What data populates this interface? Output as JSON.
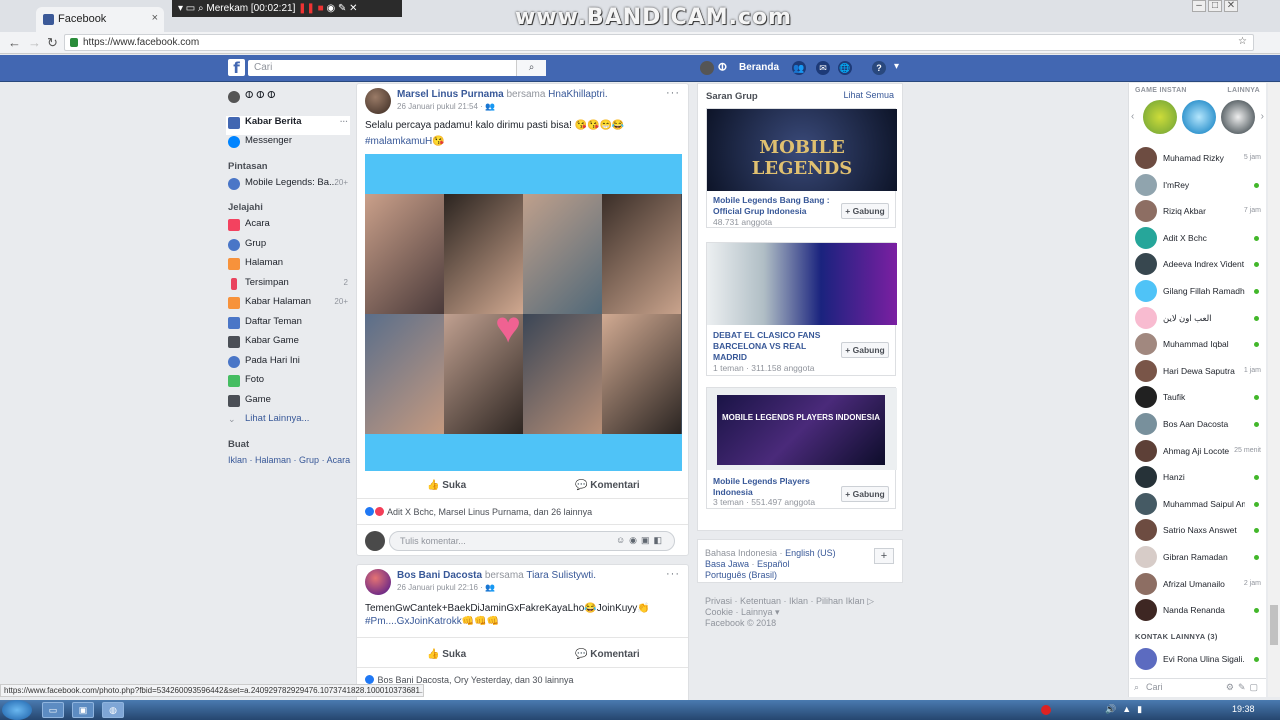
{
  "browser": {
    "tab_title": "Facebook",
    "tab_close": "×",
    "url": "https://www.facebook.com",
    "back": "←",
    "forward": "→",
    "reload": "C"
  },
  "recorder": {
    "status": "Merekam [00:02:21]",
    "watermark": "www.BANDICAM.com"
  },
  "fb_header": {
    "search_placeholder": "Cari",
    "search_icon": "⌕",
    "user_name": "ⵀ",
    "home_label": "Beranda",
    "help": "?",
    "menu": "▾"
  },
  "left_nav": {
    "profile_name": "ⵀ ⵀ ⵀ",
    "main_items": [
      {
        "label": "Kabar Berita",
        "extra": "···"
      },
      {
        "label": "Messenger",
        "extra": ""
      }
    ],
    "shortcuts_heading": "Pintasan",
    "shortcuts": [
      {
        "label": "Mobile Legends: Ba...",
        "count": "20+"
      }
    ],
    "explore_heading": "Jelajahi",
    "explore": [
      {
        "label": "Acara",
        "count": ""
      },
      {
        "label": "Grup",
        "count": ""
      },
      {
        "label": "Halaman",
        "count": ""
      },
      {
        "label": "Tersimpan",
        "count": "2"
      },
      {
        "label": "Kabar Halaman",
        "count": "20+"
      },
      {
        "label": "Daftar Teman",
        "count": ""
      },
      {
        "label": "Kabar Game",
        "count": ""
      },
      {
        "label": "Pada Hari Ini",
        "count": ""
      },
      {
        "label": "Foto",
        "count": ""
      },
      {
        "label": "Game",
        "count": ""
      },
      {
        "label": "Lihat Lainnya...",
        "count": ""
      }
    ],
    "create_heading": "Buat",
    "create_links": [
      "Iklan",
      "Halaman",
      "Grup",
      "Acara"
    ]
  },
  "posts": [
    {
      "author": "Marsel Linus Purnama",
      "with_text": "bersama",
      "tagged": "HnaKhillaptri.",
      "time": "26 Januari pukul 21:54 · ",
      "text": "Selalu percaya padamu! kalo dirimu pasti bisa! 😘😘😁😂",
      "hashtag": "#malamkamuH😘",
      "like_label": "Suka",
      "comment_label": "Komentari",
      "reactions": "Adit X Bchc, Marsel Linus Purnama, dan 26 lainnya",
      "comment_placeholder": "Tulis komentar..."
    },
    {
      "author": "Bos Bani Dacosta",
      "with_text": "bersama",
      "tagged": "Tiara Sulistywti.",
      "time": "26 Januari pukul 22:16 · ",
      "text": "TemenGwCantek+BaekDiJaminGxFakreKayaLho😂JoinKuyy👏",
      "hashtag": "#Pm....GxJoinKatrokk👊👊👊",
      "like_label": "Suka",
      "comment_label": "Komentari",
      "reactions": "Bos Bani Dacosta, Ory Yesterday, dan 30 lainnya"
    }
  ],
  "suggested_groups": {
    "heading": "Saran Grup",
    "see_all": "Lihat Semua",
    "join_label": "+ Gabung",
    "groups": [
      {
        "name": "Mobile Legends Bang Bang : Official Grup Indonesia",
        "members": "48.731 anggota",
        "image_text": "MOBILE LEGENDS"
      },
      {
        "name": "DEBAT EL CLASICO FANS BARCELONA VS REAL MADRID",
        "members": "1 teman · 311.158 anggota",
        "image_text": ""
      },
      {
        "name": "Mobile Legends Players Indonesia",
        "members": "3 teman · 551.497 anggota",
        "image_text": "MOBILE LEGENDS PLAYERS INDONESIA"
      }
    ]
  },
  "footer": {
    "languages_line1": "Bahasa Indonesia · ",
    "lang_en": "English (US)",
    "lang_jv": "Basa Jawa",
    "lang_es": "Español",
    "lang_pt": "Português (Brasil)",
    "add": "+",
    "links_line1": "Privasi · Ketentuan · Iklan · Pilihan Iklan ▷",
    "links_line2": "Cookie · Lainnya ▾",
    "copyright": "Facebook © 2018"
  },
  "chat": {
    "games_heading": "GAME INSTAN",
    "games_more": "LAINNYA",
    "contacts": [
      {
        "name": "Muhamad Rizky",
        "status": "5 jam",
        "online": false,
        "color": "#6d4c41"
      },
      {
        "name": "I'mRey",
        "status": "",
        "online": true,
        "color": "#90a4ae"
      },
      {
        "name": "Riziq Akbar",
        "status": "7 jam",
        "online": false,
        "color": "#8d6e63"
      },
      {
        "name": "Adit X Bchc",
        "status": "",
        "online": true,
        "color": "#26a69a"
      },
      {
        "name": "Adeeva Indrex Vident X",
        "status": "",
        "online": true,
        "color": "#37474f"
      },
      {
        "name": "Gilang Fillah Ramadh...",
        "status": "",
        "online": true,
        "color": "#4fc3f7"
      },
      {
        "name": "العب اون لاين",
        "status": "",
        "online": true,
        "color": "#f8bbd0"
      },
      {
        "name": "Muhammad Iqbal",
        "status": "",
        "online": true,
        "color": "#a1887f"
      },
      {
        "name": "Hari Dewa Saputra",
        "status": "1 jam",
        "online": false,
        "color": "#795548"
      },
      {
        "name": "Taufik",
        "status": "",
        "online": true,
        "color": "#212121"
      },
      {
        "name": "Bos Aan Dacosta",
        "status": "",
        "online": true,
        "color": "#78909c"
      },
      {
        "name": "Ahmag Aji Locote",
        "status": "25 menit",
        "online": false,
        "color": "#5d4037"
      },
      {
        "name": "Hanzi",
        "status": "",
        "online": true,
        "color": "#263238"
      },
      {
        "name": "Muhammad Saipul Anwar",
        "status": "",
        "online": true,
        "color": "#455a64"
      },
      {
        "name": "Satrio Naxs Answet",
        "status": "",
        "online": true,
        "color": "#6d4c41"
      },
      {
        "name": "Gibran Ramadan",
        "status": "",
        "online": true,
        "color": "#d7ccc8"
      },
      {
        "name": "Afrizal Umanailo",
        "status": "2 jam",
        "online": false,
        "color": "#8d6e63"
      },
      {
        "name": "Nanda Renanda",
        "status": "",
        "online": true,
        "color": "#3e2723"
      }
    ],
    "more_contacts_heading": "KONTAK LAINNYA (3)",
    "more_contacts": [
      {
        "name": "Evi Rona Ulina Sigali...",
        "status": "",
        "online": true,
        "color": "#5c6bc0"
      }
    ],
    "search_placeholder": "Cari"
  },
  "status_bar_url": "https://www.facebook.com/photo.php?fbid=534260093596442&set=a.240929782929476.1073741828.100010373681...",
  "taskbar": {
    "clock": "19:38"
  },
  "colors": {
    "fb_blue": "#4267b2",
    "link": "#385898",
    "online": "#42b72a"
  }
}
